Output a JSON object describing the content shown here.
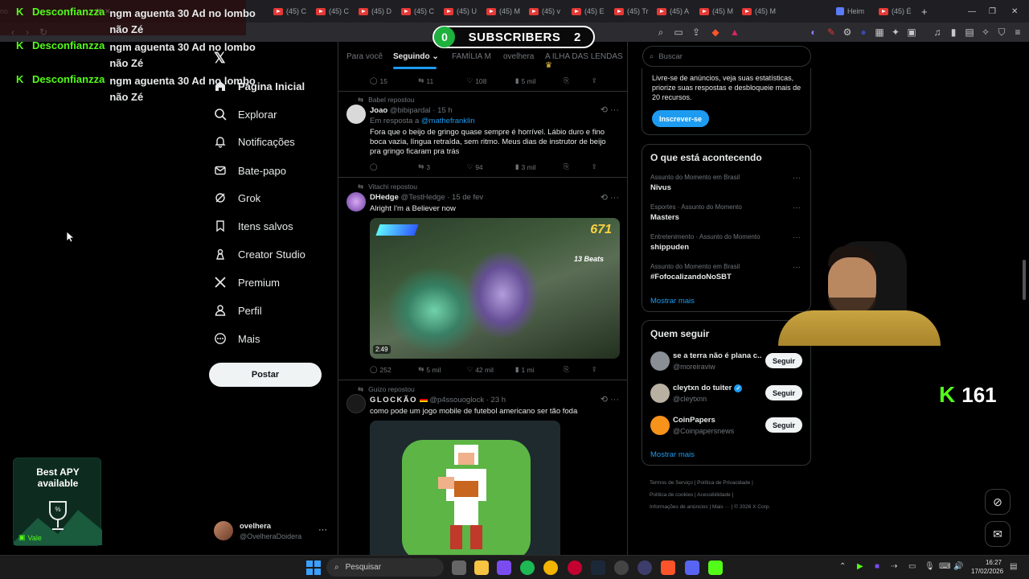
{
  "browser": {
    "tabs": [
      {
        "label": "no"
      },
      {
        "label": "(45) C"
      },
      {
        "label": "(45) C"
      },
      {
        "label": "(45) D"
      },
      {
        "label": "(45) C"
      },
      {
        "label": "(45) U"
      },
      {
        "label": "(45) M"
      },
      {
        "label": "(45) v"
      },
      {
        "label": "(45) E"
      },
      {
        "label": "(45) Tr"
      },
      {
        "label": "(45) A"
      },
      {
        "label": "(45) M"
      },
      {
        "label": "(45) M"
      },
      {
        "label": "Heim"
      },
      {
        "label": "(45) É"
      }
    ]
  },
  "overlay": {
    "chat": [
      {
        "user": "Desconfianzza",
        "message": "ngm aguenta 30 Ad no lombo não Zé"
      },
      {
        "user": "Desconfianzza",
        "message": "ngm aguenta 30 Ad no lombo não Zé"
      },
      {
        "user": "Desconfianzza",
        "message": "ngm aguenta 30 Ad no lombo não Zé"
      }
    ],
    "subscribers": {
      "left": "0",
      "label": "SUBSCRIBERS",
      "right": "2"
    },
    "kick_viewers": "161",
    "ad": {
      "line1": "Best APY",
      "line2": "available",
      "brand": "Vale"
    }
  },
  "nav": {
    "items": [
      {
        "label": "Página Inicial",
        "icon": "home-icon"
      },
      {
        "label": "Explorar",
        "icon": "search-icon"
      },
      {
        "label": "Notificações",
        "icon": "bell-icon"
      },
      {
        "label": "Bate-papo",
        "icon": "mail-icon"
      },
      {
        "label": "Grok",
        "icon": "grok-icon"
      },
      {
        "label": "Itens salvos",
        "icon": "bookmark-icon"
      },
      {
        "label": "Creator Studio",
        "icon": "creator-icon"
      },
      {
        "label": "Premium",
        "icon": "x-icon"
      },
      {
        "label": "Perfil",
        "icon": "user-icon"
      },
      {
        "label": "Mais",
        "icon": "more-icon"
      }
    ],
    "post_button": "Postar",
    "account": {
      "name": "ovelhera",
      "handle": "@OvelheraDoidera"
    }
  },
  "feed": {
    "tabs": [
      "Para você",
      "Seguindo",
      "FAMÍLIA M",
      "ovelhera",
      "A ILHA DAS LENDAS"
    ],
    "top_actions": {
      "replies": "15",
      "reposts": "11",
      "likes": "108",
      "views": "5 mil"
    },
    "tweets": [
      {
        "repost_by": "Babel repostou",
        "name": "Joao",
        "handle": "@bibipardal",
        "time": "· 15 h",
        "reply_to_label": "Em resposta a",
        "reply_to": "@mathefranklin",
        "text": "Fora que o beijo de gringo quase sempre é horrível. Lábio duro e fino boca vazia, língua retraída, sem ritmo. Meus dias de instrutor de beijo pra gringo ficaram pra trás",
        "actions": {
          "replies": "",
          "reposts": "3",
          "likes": "94",
          "views": "3 mil"
        }
      },
      {
        "repost_by": "Vitachi repostou",
        "name": "DHedge",
        "handle": "@TestHedge",
        "time": "· 15 de fev",
        "text": "Alright I'm a Believer now",
        "video": {
          "score": "671",
          "beats": "13 Beats",
          "duration": "2:49"
        },
        "actions": {
          "replies": "252",
          "reposts": "5 mil",
          "likes": "42 mil",
          "views": "1 mi"
        }
      },
      {
        "repost_by": "Guizo repostou",
        "name": "GLOCKÃO",
        "handle": "@p4ssouoglock",
        "time": "· 23 h",
        "text": "como pode um jogo mobile de futebol americano ser tão foda"
      }
    ]
  },
  "sidebar": {
    "search_placeholder": "Buscar",
    "premium": {
      "text": "Livre-se de anúncios, veja suas estatísticas, priorize suas respostas e desbloqueie mais de 20 recursos.",
      "button": "Inscrever-se"
    },
    "trends": {
      "title": "O que está acontecendo",
      "items": [
        {
          "category": "Assunto do Momento em Brasil",
          "name": "Nivus"
        },
        {
          "category": "Esportes · Assunto do Momento",
          "name": "Masters"
        },
        {
          "category": "Entretenimento · Assunto do Momento",
          "name": "shippuden"
        },
        {
          "category": "Assunto do Momento em Brasil",
          "name": "#FofocalizandoNoSBT"
        }
      ],
      "show_more": "Mostrar mais"
    },
    "who_to_follow": {
      "title": "Quem seguir",
      "users": [
        {
          "name": "se a terra não é plana c...",
          "handle": "@moreiraviw",
          "button": "Seguir"
        },
        {
          "name": "cleytxn do tuiter",
          "handle": "@cleytxnn",
          "button": "Seguir"
        },
        {
          "name": "CoinPapers",
          "handle": "@Coinpapersnews",
          "button": "Seguir"
        }
      ],
      "show_more": "Mostrar mais"
    },
    "footer": [
      "Termos de Serviço",
      "Política de Privacidade",
      "Política de cookies",
      "Acessibilidade",
      "Informações de anúncios",
      "Mais ···",
      "© 2026 X Corp."
    ]
  },
  "taskbar": {
    "search": "Pesquisar",
    "time": "16:27",
    "date": "17/02/2026"
  }
}
